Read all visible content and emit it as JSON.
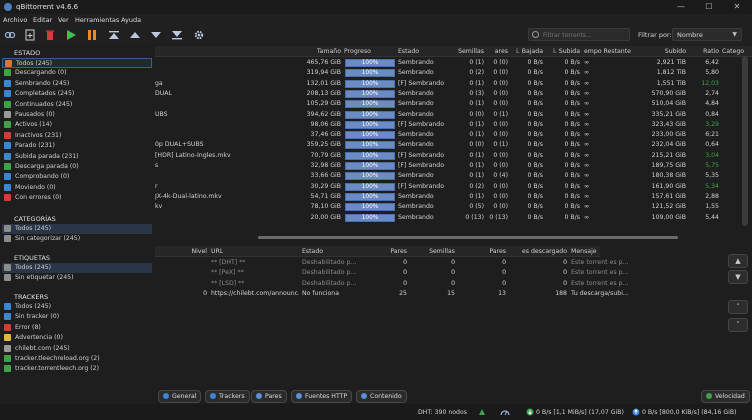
{
  "window": {
    "title": "qBittorrent v4.6.6"
  },
  "menu": [
    "Archivo",
    "Editar",
    "Ver",
    "Herramientas",
    "Ayuda"
  ],
  "toolbar": {
    "search_placeholder": "Filtrar torrents...",
    "filter_label": "Filtrar por:",
    "filter_value": "Nombre"
  },
  "sidebar": {
    "estado_title": "ESTADO",
    "estado": [
      {
        "label": "Todos (245)",
        "color": "#e0742e"
      },
      {
        "label": "Descargando (0)",
        "color": "#3fa24b"
      },
      {
        "label": "Sembrando (245)",
        "color": "#3a86d6"
      },
      {
        "label": "Completados (245)",
        "color": "#3a86d6"
      },
      {
        "label": "Continuados (245)",
        "color": "#3fa24b"
      },
      {
        "label": "Pausados (0)",
        "color": "#9a9a9a"
      },
      {
        "label": "Activos (14)",
        "color": "#3fa24b"
      },
      {
        "label": "Inactivos (231)",
        "color": "#d43b3b"
      },
      {
        "label": "Parado (231)",
        "color": "#3a86d6"
      },
      {
        "label": "Subida parada (231)",
        "color": "#3a86d6"
      },
      {
        "label": "Descarga parada (0)",
        "color": "#3fa24b"
      },
      {
        "label": "Comprobando (0)",
        "color": "#3a86d6"
      },
      {
        "label": "Moviendo (0)",
        "color": "#3a86d6"
      },
      {
        "label": "Con errores (0)",
        "color": "#d43b3b"
      }
    ],
    "categorias_title": "CATEGORÍAS",
    "categorias": [
      {
        "label": "Todos (245)"
      },
      {
        "label": "Sin categorizar (245)"
      }
    ],
    "etiquetas_title": "ETIQUETAS",
    "etiquetas": [
      {
        "label": "Todos (245)"
      },
      {
        "label": "Sin etiquetar (245)"
      }
    ],
    "trackers_title": "TRACKERS",
    "trackers": [
      {
        "label": "Todos (245)",
        "color": "#3a86d6"
      },
      {
        "label": "Sin tracker (0)",
        "color": "#3a86d6"
      },
      {
        "label": "Error (8)",
        "color": "#d43b3b"
      },
      {
        "label": "Advertencia (0)",
        "color": "#e0b92e"
      },
      {
        "label": "chilebt.com (245)",
        "color": "#9a9a9a"
      },
      {
        "label": "tracker.tleechreload.org (2)",
        "color": "#3fa24b"
      },
      {
        "label": "tracker.torrentleech.org (2)",
        "color": "#3fa24b"
      }
    ]
  },
  "columns": [
    "Tamaño",
    "Progreso",
    "Estado",
    "Semillas",
    "ares",
    "i. Bajada",
    "i. Subida",
    "empo Restante",
    "Subido",
    "Ratio",
    "Catego"
  ],
  "rows": [
    {
      "name": "",
      "size": "465,76 GiB",
      "progress": "100%",
      "status": "Sembrando",
      "seeds": "0 (1)",
      "peers": "0 (0)",
      "down": "0 B/s",
      "up": "0 B/s",
      "eta": "∞",
      "uploaded": "2,921 TiB",
      "ratio": "6,42",
      "ratio_color": "#d2d2d2"
    },
    {
      "name": "",
      "size": "319,94 GiB",
      "progress": "100%",
      "status": "Sembrando",
      "seeds": "0 (2)",
      "peers": "0 (0)",
      "down": "0 B/s",
      "up": "0 B/s",
      "eta": "∞",
      "uploaded": "1,812 TiB",
      "ratio": "5,80",
      "ratio_color": "#d2d2d2"
    },
    {
      "name": "ga",
      "size": "132,01 GiB",
      "progress": "100%",
      "status": "[F] Sembrando",
      "seeds": "0 (1)",
      "peers": "0 (0)",
      "down": "0 B/s",
      "up": "0 B/s",
      "eta": "∞",
      "uploaded": "1,551 TiB",
      "ratio": "12,03",
      "ratio_color": "#3fa24b"
    },
    {
      "name": "DUAL",
      "size": "208,13 GiB",
      "progress": "100%",
      "status": "Sembrando",
      "seeds": "0 (3)",
      "peers": "0 (0)",
      "down": "0 B/s",
      "up": "0 B/s",
      "eta": "∞",
      "uploaded": "570,90 GiB",
      "ratio": "2,74",
      "ratio_color": "#d2d2d2"
    },
    {
      "name": "",
      "size": "105,29 GiB",
      "progress": "100%",
      "status": "Sembrando",
      "seeds": "0 (1)",
      "peers": "0 (0)",
      "down": "0 B/s",
      "up": "0 B/s",
      "eta": "∞",
      "uploaded": "510,04 GiB",
      "ratio": "4,84",
      "ratio_color": "#d2d2d2"
    },
    {
      "name": "UBS",
      "size": "394,62 GiB",
      "progress": "100%",
      "status": "Sembrando",
      "seeds": "0 (0)",
      "peers": "0 (1)",
      "down": "0 B/s",
      "up": "0 B/s",
      "eta": "∞",
      "uploaded": "335,21 GiB",
      "ratio": "0,84",
      "ratio_color": "#d2d2d2"
    },
    {
      "name": "",
      "size": "98,06 GiB",
      "progress": "100%",
      "status": "[F] Sembrando",
      "seeds": "0 (1)",
      "peers": "0 (0)",
      "down": "0 B/s",
      "up": "0 B/s",
      "eta": "∞",
      "uploaded": "323,43 GiB",
      "ratio": "3,29",
      "ratio_color": "#3fa24b"
    },
    {
      "name": "",
      "size": "37,46 GiB",
      "progress": "100%",
      "status": "Sembrando",
      "seeds": "0 (1)",
      "peers": "0 (0)",
      "down": "0 B/s",
      "up": "0 B/s",
      "eta": "∞",
      "uploaded": "233,00 GiB",
      "ratio": "6,21",
      "ratio_color": "#d2d2d2"
    },
    {
      "name": "0p DUAL+SUBS",
      "size": "359,25 GiB",
      "progress": "100%",
      "status": "Sembrando",
      "seeds": "0 (0)",
      "peers": "0 (1)",
      "down": "0 B/s",
      "up": "0 B/s",
      "eta": "∞",
      "uploaded": "232,04 GiB",
      "ratio": "0,64",
      "ratio_color": "#d2d2d2"
    },
    {
      "name": "[HDR] Latino-Ingles.mkv",
      "size": "70,79 GiB",
      "progress": "100%",
      "status": "[F] Sembrando",
      "seeds": "0 (1)",
      "peers": "0 (0)",
      "down": "0 B/s",
      "up": "0 B/s",
      "eta": "∞",
      "uploaded": "215,21 GiB",
      "ratio": "3,04",
      "ratio_color": "#3fa24b"
    },
    {
      "name": "s",
      "size": "32,98 GiB",
      "progress": "100%",
      "status": "[F] Sembrando",
      "seeds": "0 (1)",
      "peers": "0 (0)",
      "down": "0 B/s",
      "up": "0 B/s",
      "eta": "∞",
      "uploaded": "189,75 GiB",
      "ratio": "5,75",
      "ratio_color": "#3fa24b"
    },
    {
      "name": "",
      "size": "33,66 GiB",
      "progress": "100%",
      "status": "Sembrando",
      "seeds": "0 (1)",
      "peers": "0 (4)",
      "down": "0 B/s",
      "up": "0 B/s",
      "eta": "∞",
      "uploaded": "180,38 GiB",
      "ratio": "5,35",
      "ratio_color": "#d2d2d2"
    },
    {
      "name": "r",
      "size": "30,29 GiB",
      "progress": "100%",
      "status": "[F] Sembrando",
      "seeds": "0 (2)",
      "peers": "0 (0)",
      "down": "0 B/s",
      "up": "0 B/s",
      "eta": "∞",
      "uploaded": "161,90 GiB",
      "ratio": "5,34",
      "ratio_color": "#3fa24b"
    },
    {
      "name": "JX-4k-Dual-latino.mkv",
      "size": "54,71 GiB",
      "progress": "100%",
      "status": "Sembrando",
      "seeds": "0 (1)",
      "peers": "0 (0)",
      "down": "0 B/s",
      "up": "0 B/s",
      "eta": "∞",
      "uploaded": "157,61 GiB",
      "ratio": "2,88",
      "ratio_color": "#d2d2d2"
    },
    {
      "name": "kv",
      "size": "78,10 GiB",
      "progress": "100%",
      "status": "Sembrando",
      "seeds": "0 (5)",
      "peers": "0 (0)",
      "down": "0 B/s",
      "up": "0 B/s",
      "eta": "∞",
      "uploaded": "121,52 GiB",
      "ratio": "1,55",
      "ratio_color": "#d2d2d2"
    },
    {
      "name": "",
      "size": "20,00 GiB",
      "progress": "100%",
      "status": "Sembrando",
      "seeds": "0 (13)",
      "peers": "0 (13)",
      "down": "0 B/s",
      "up": "0 B/s",
      "eta": "∞",
      "uploaded": "109,00 GiB",
      "ratio": "5,44",
      "ratio_color": "#d2d2d2"
    }
  ],
  "tracker_columns": [
    "Nivel",
    "URL",
    "Estado",
    "Pares",
    "Semillas",
    "Pares",
    "es descargado",
    "Mensaje"
  ],
  "tracker_rows": [
    {
      "level": "",
      "url": "** [DHT] **",
      "status": "Deshabilitado p...",
      "peers": "0",
      "seeds": "0",
      "leeches": "0",
      "downloaded": "0",
      "message": "Este torrent es p..."
    },
    {
      "level": "",
      "url": "** [PeX] **",
      "status": "Deshabilitado p...",
      "peers": "0",
      "seeds": "0",
      "leeches": "0",
      "downloaded": "0",
      "message": "Este torrent es p..."
    },
    {
      "level": "",
      "url": "** [LSD] **",
      "status": "Deshabilitado p...",
      "peers": "0",
      "seeds": "0",
      "leeches": "0",
      "downloaded": "0",
      "message": "Este torrent es p..."
    },
    {
      "level": "0",
      "url": "https://chilebt.com/announc...",
      "status": "No funciona",
      "peers": "25",
      "seeds": "15",
      "leeches": "13",
      "downloaded": "188",
      "message": "Tu descarga/subi..."
    }
  ],
  "tabs": [
    "General",
    "Trackers",
    "Pares",
    "Fuentes HTTP",
    "Contenido"
  ],
  "speed_button": "Velocidad",
  "status": {
    "dht": "DHT: 390 nodos",
    "down": "0 B/s [1,1 MiB/s] (17,07 GiB)",
    "up": "0 B/s [800,0 KiB/s] (84,16 GiB)"
  }
}
